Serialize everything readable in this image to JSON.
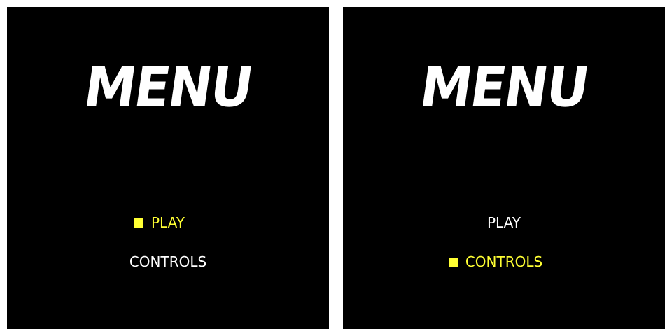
{
  "colors": {
    "background": "#000000",
    "frame": "#ffffff",
    "text": "#ffffff",
    "selected": "#ffff33"
  },
  "screens": [
    {
      "title": "MENU",
      "items": [
        {
          "label": "PLAY",
          "selected": true
        },
        {
          "label": "CONTROLS",
          "selected": false
        }
      ]
    },
    {
      "title": "MENU",
      "items": [
        {
          "label": "PLAY",
          "selected": false
        },
        {
          "label": "CONTROLS",
          "selected": true
        }
      ]
    }
  ],
  "selector_icon": "filled-square-icon"
}
